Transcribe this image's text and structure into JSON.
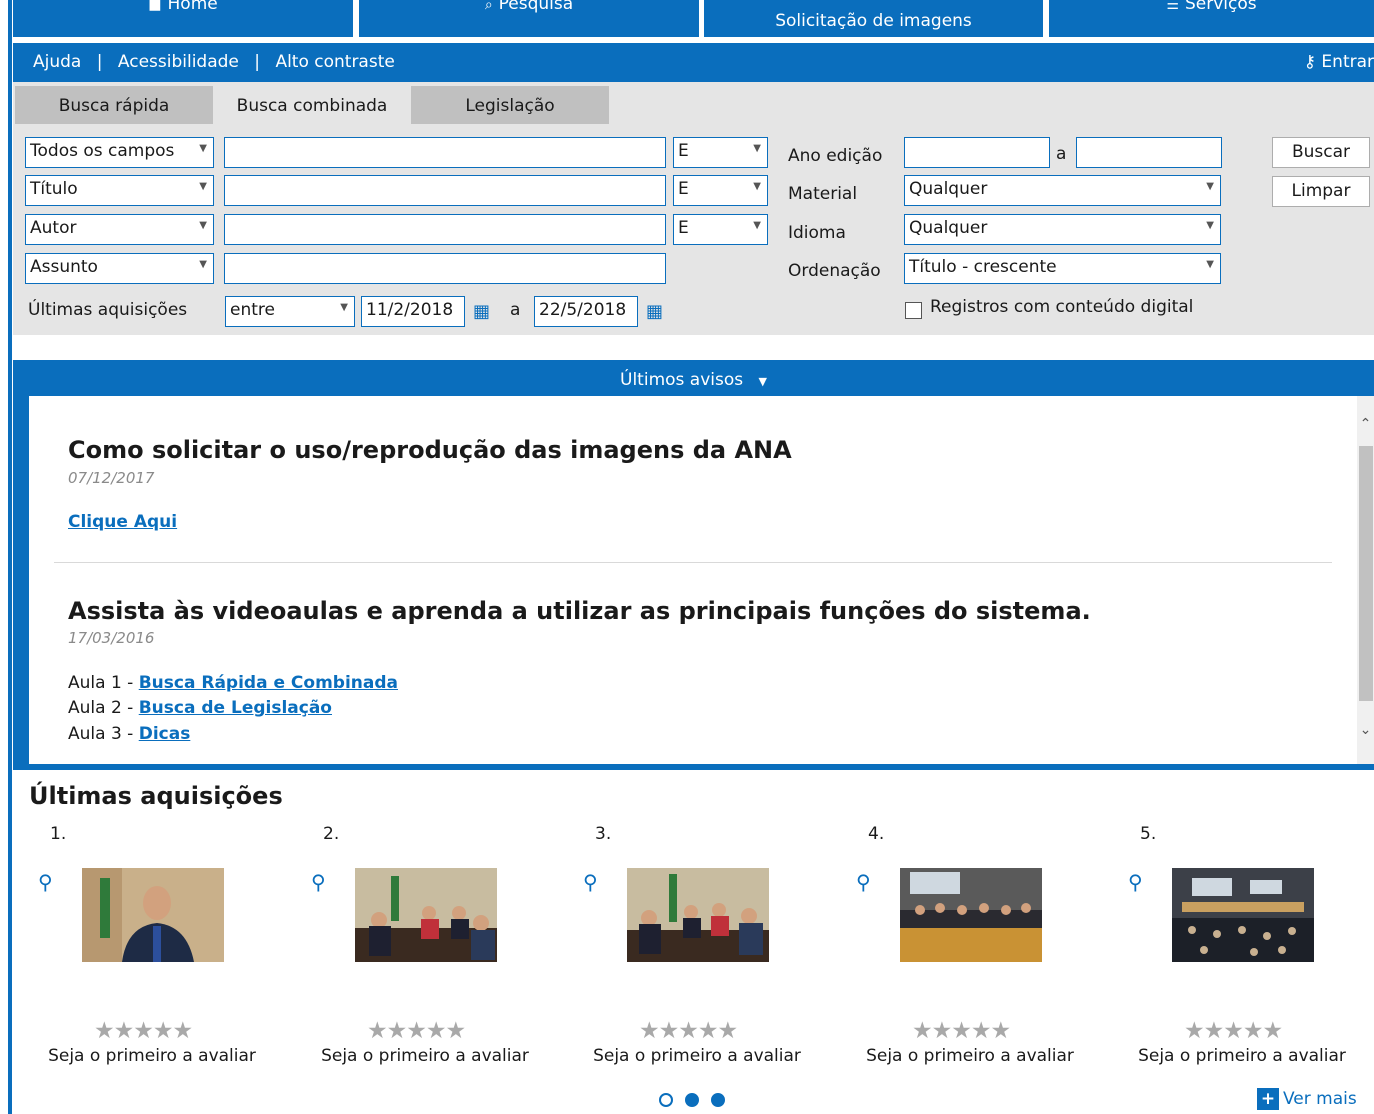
{
  "topnav": {
    "tabs": [
      {
        "label": "Home",
        "icon": "home-icon"
      },
      {
        "label": "Pesquisa",
        "icon": "search-icon"
      },
      {
        "label": "Solicitação de imagens",
        "icon": ""
      },
      {
        "label": "Serviços",
        "icon": "list-icon"
      }
    ]
  },
  "utilbar": {
    "links": [
      "Ajuda",
      "Acessibilidade",
      "Alto contraste"
    ],
    "separator": "|",
    "login": "Entrar"
  },
  "search": {
    "tabs": [
      "Busca rápida",
      "Busca combinada",
      "Legislação"
    ],
    "active_tab": "Busca combinada",
    "rows": [
      {
        "field": "Todos os campos",
        "value": "",
        "op": "E"
      },
      {
        "field": "Título",
        "value": "",
        "op": "E"
      },
      {
        "field": "Autor",
        "value": "",
        "op": "E"
      },
      {
        "field": "Assunto",
        "value": ""
      }
    ],
    "ultimas_aquisicoes_label": "Últimas aquisições",
    "range_select": "entre",
    "date_from": "11/2/2018",
    "date_to": "22/5/2018",
    "a_label": "a",
    "ano_edicao_label": "Ano edição",
    "material_label": "Material",
    "material_value": "Qualquer",
    "idioma_label": "Idioma",
    "idioma_value": "Qualquer",
    "ordenacao_label": "Ordenação",
    "ordenacao_value": "Título - crescente",
    "digital_label": "Registros com conteúdo digital",
    "buscar": "Buscar",
    "limpar": "Limpar"
  },
  "notices": {
    "header": "Últimos avisos",
    "items": [
      {
        "title": "Como solicitar o uso/reprodução das imagens da ANA",
        "date": "07/12/2017",
        "link": "Clique Aqui"
      },
      {
        "title": "Assista às videoaulas e aprenda a utilizar as principais funções do sistema.",
        "date": "17/03/2016"
      }
    ],
    "aulas": [
      {
        "prefix": "Aula 1 - ",
        "link": "Busca Rápida e Combinada"
      },
      {
        "prefix": "Aula 2 - ",
        "link": "Busca de Legislação"
      },
      {
        "prefix": "Aula 3 - ",
        "link": "Dicas"
      }
    ]
  },
  "acquisitions": {
    "title": "Últimas aquisições",
    "items": [
      {
        "num": "1.",
        "rating_text": "Seja o primeiro a avaliar"
      },
      {
        "num": "2.",
        "rating_text": "Seja o primeiro a avaliar"
      },
      {
        "num": "3.",
        "rating_text": "Seja o primeiro a avaliar"
      },
      {
        "num": "4.",
        "rating_text": "Seja o primeiro a avaliar"
      },
      {
        "num": "5.",
        "rating_text": "Seja o primeiro a avaliar"
      }
    ],
    "stars": "★★★★★",
    "ver_mais": "Ver mais"
  },
  "colors": {
    "accent": "#0a6ebd",
    "panel": "#e5e5e5"
  }
}
